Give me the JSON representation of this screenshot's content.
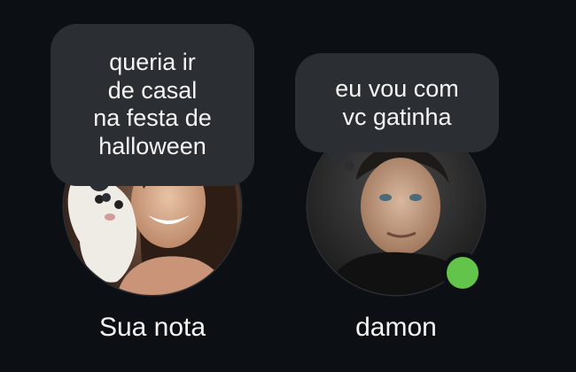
{
  "notes": [
    {
      "user_label": "Sua nota",
      "note_text": "queria ir\nde casal\nna festa de\nhalloween",
      "avatar_icon": "profile-photo-woman-with-dog"
    },
    {
      "user_label": "damon",
      "note_text": "eu vou com\nvc gatinha",
      "avatar_icon": "profile-photo-man",
      "status": "online",
      "status_color": "#62c44b"
    }
  ],
  "colors": {
    "background": "#0c1014",
    "bubble": "#2b2f34",
    "text": "#f5f5f5"
  }
}
